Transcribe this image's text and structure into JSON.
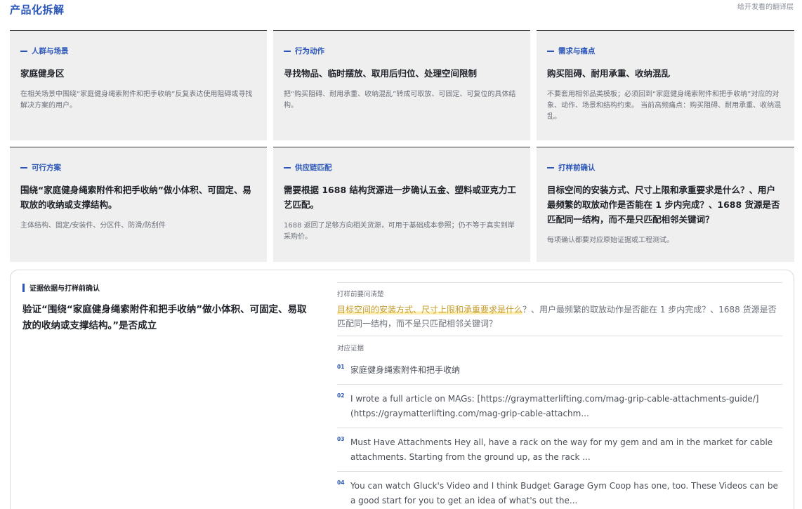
{
  "header": {
    "title": "产品化拆解",
    "note": "给开发看的翻译层"
  },
  "cards": [
    {
      "tag": "人群与场景",
      "title": "家庭健身区",
      "desc": "在相关场景中围绕“家庭健身绳索附件和把手收纳”反复表达使用阻碍或寻找解决方案的用户。"
    },
    {
      "tag": "行为动作",
      "title": "寻找物品、临时摆放、取用后归位、处理空间限制",
      "desc": "把“购买阻碍、耐用承重、收纳混乱”转成可取放、可固定、可复位的具体结构。"
    },
    {
      "tag": "需求与痛点",
      "title": "购买阻碍、耐用承重、收纳混乱",
      "desc": "不要套用相邻品类模板；必须回到“家庭健身绳索附件和把手收纳”对应的对象、动作、场景和结构约束。 当前高频痛点：购买阻碍、耐用承重、收纳混乱。"
    },
    {
      "tag": "可行方案",
      "title": "围绕“家庭健身绳索附件和把手收纳”做小体积、可固定、易取放的收纳或支撑结构。",
      "desc": "主体结构、固定/安装件、分区件、防滑/防刮件"
    },
    {
      "tag": "供应链匹配",
      "title": "需要根据 1688 结构货源进一步确认五金、塑料或亚克力工艺匹配。",
      "desc": "1688 返回了足够方向相关货源，可用于基础成本参照；仍不等于真实到岸采购价。"
    },
    {
      "tag": "打样前确认",
      "title": "目标空间的安装方式、尺寸上限和承重要求是什么？、用户最频繁的取放动作是否能在 1 步内完成？、1688 货源是否匹配同一结构，而不是只匹配相邻关键词？",
      "desc": "每项确认都要对应原始证据或工程测试。"
    }
  ],
  "evidence": {
    "tag": "证据依据与打样前确认",
    "title": "验证“围绕“家庭健身绳索附件和把手收纳”做小体积、可固定、易取放的收纳或支撑结构。”是否成立",
    "question_label": "打样前要问清楚",
    "question_highlight": "目标空间的安装方式、尺寸上限和承重要求是什么",
    "question_rest": "？、用户最频繁的取放动作是否能在 1 步内完成？、1688 货源是否匹配同一结构，而不是只匹配相邻关键词？",
    "list_label": "对应证据",
    "items": [
      {
        "num": "01",
        "text": "家庭健身绳索附件和把手收纳"
      },
      {
        "num": "02",
        "text": "I wrote a full article on MAGs: [https://graymatterlifting.com/mag-grip-cable-attachments-guide/](https://graymatterlifting.com/mag-grip-cable-attachm..."
      },
      {
        "num": "03",
        "text": "Must Have Attachments Hey all, have a rack on the way for my gem and am in the market for cable attachments. Starting from the ground up, as the rack ..."
      },
      {
        "num": "04",
        "text": "You can watch Gluck's Video and I think Budget Garage Gym Coop has one, too. These Videos can be a good start for you to get an idea of what's out the..."
      }
    ]
  }
}
